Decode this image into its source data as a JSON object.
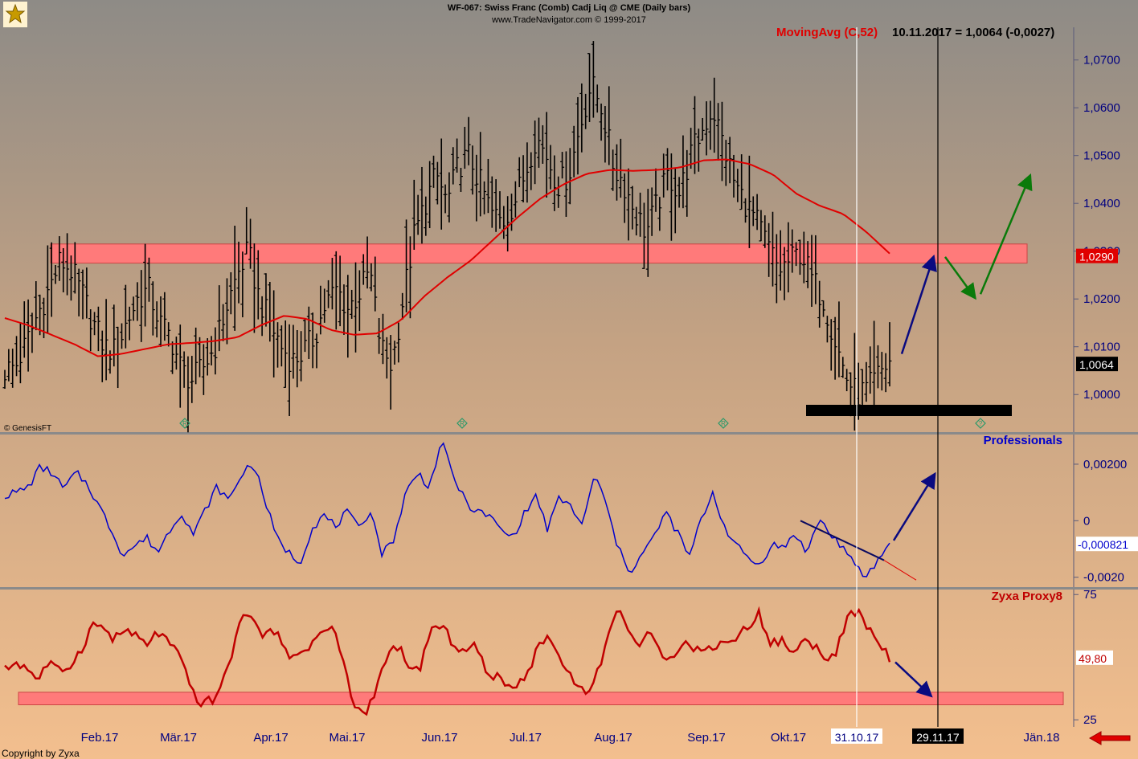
{
  "header": {
    "title": "WF-067:  Swiss Franc (Comb) Cadj Liq @ CME  (Daily bars)",
    "subtitle": "www.TradeNavigator.com © 1999-2017"
  },
  "logo_text": "GenesisFT",
  "copyright_left": "© GenesisFT",
  "footer_copyright": "Copyright by Zyxa",
  "colors": {
    "bg_top": "#8e8b86",
    "bg_bottom": "#f3bf8e",
    "price_bars": "#000000",
    "moving_avg": "#e00000",
    "professionals": "#0000cc",
    "zyxa": "#c00000",
    "zone": "#ff7a7a",
    "arrow_blue": "#0a0a80",
    "arrow_green": "#0a7a0a",
    "axis_text": "#000080"
  },
  "chart_data": [
    {
      "type": "ohlc",
      "panel": "price",
      "title": "WF-067:  Swiss Franc (Comb) Cadj Liq @ CME  (Daily bars)",
      "indicator_label": "MovingAvg (C,52)",
      "readout": "10.11.2017 = 1,0064 (-0,0027)",
      "last_value_label": "1,0064",
      "zone_value_label": "1,0290",
      "zone_range": [
        1.0275,
        1.0315
      ],
      "ylim": [
        0.9955,
        1.0765
      ],
      "yticks": [
        1.0,
        1.01,
        1.02,
        1.03,
        1.04,
        1.05,
        1.06,
        1.07
      ],
      "ytick_labels": [
        "1,0000",
        "1,0100",
        "1,0200",
        "1,0300",
        "1,0400",
        "1,0500",
        "1,0600",
        "1,0700"
      ],
      "close_path": [
        1.005,
        1.006,
        1.011,
        1.017,
        1.022,
        1.028,
        1.026,
        1.021,
        1.015,
        1.01,
        1.009,
        1.015,
        1.02,
        1.022,
        1.015,
        1.012,
        1.005,
        1.003,
        1.006,
        1.01,
        1.018,
        1.025,
        1.03,
        1.02,
        1.015,
        1.01,
        1.007,
        1.009,
        1.012,
        1.019,
        1.022,
        1.018,
        1.021,
        1.026,
        1.01,
        1.006,
        1.02,
        1.033,
        1.04,
        1.046,
        1.04,
        1.048,
        1.05,
        1.044,
        1.038,
        1.036,
        1.04,
        1.046,
        1.054,
        1.05,
        1.044,
        1.046,
        1.056,
        1.065,
        1.06,
        1.048,
        1.044,
        1.038,
        1.034,
        1.04,
        1.046,
        1.042,
        1.05,
        1.055,
        1.06,
        1.052,
        1.044,
        1.04,
        1.036,
        1.031,
        1.026,
        1.028,
        1.03,
        1.024,
        1.02,
        1.012,
        1.004,
        1.0,
        1.001,
        1.004,
        1.007
      ],
      "moving_avg_path": [
        1.016,
        1.0145,
        1.0125,
        1.0105,
        1.008,
        1.0085,
        1.0095,
        1.0105,
        1.0108,
        1.0112,
        1.012,
        1.0145,
        1.0165,
        1.0158,
        1.0135,
        1.0125,
        1.0128,
        1.0155,
        1.0205,
        1.0245,
        1.028,
        1.0325,
        1.037,
        1.041,
        1.044,
        1.0462,
        1.047,
        1.0468,
        1.047,
        1.0475,
        1.049,
        1.0492,
        1.0482,
        1.046,
        1.042,
        1.0395,
        1.0378,
        1.034,
        1.0295
      ],
      "x_dates": [
        "Feb.17",
        "Mär.17",
        "Apr.17",
        "Mai.17",
        "Jun.17",
        "Jul.17",
        "Aug.17",
        "Sep.17",
        "Okt.17",
        "31.10.17",
        "29.11.17",
        "Jän.18"
      ],
      "vlines": [
        "31.10.17",
        "29.11.17"
      ],
      "projection": {
        "from": 1.007,
        "up_to": 1.0285,
        "green_down": 1.0205,
        "green_up": 1.0455
      }
    },
    {
      "type": "line",
      "panel": "professionals",
      "name": "Professionals",
      "last_value_label": "-0,000821",
      "ylim": [
        -0.00235,
        0.00305
      ],
      "yticks": [
        -0.002,
        0,
        0.002
      ],
      "ytick_labels": [
        "-0,0020",
        "0",
        "0,00200"
      ],
      "values": [
        0.0009,
        0.001,
        0.0012,
        0.0019,
        0.0017,
        0.0011,
        0.0017,
        0.0013,
        0.0005,
        -0.0003,
        -0.0012,
        -0.0009,
        -0.0006,
        -0.0011,
        -0.0003,
        0.0003,
        -0.0005,
        0.0004,
        0.0012,
        0.0007,
        0.0016,
        0.0021,
        0.0008,
        -0.0006,
        -0.0011,
        -0.0015,
        -0.0003,
        0.0002,
        -0.0002,
        0.0003,
        -0.0003,
        0.0004,
        -0.0012,
        -0.0006,
        0.001,
        0.0017,
        0.0012,
        0.0028,
        0.0016,
        0.0007,
        0.0003,
        0.0002,
        -0.0003,
        -0.0006,
        0.0002,
        0.0009,
        -0.0003,
        0.0008,
        0.0005,
        -0.0002,
        0.0017,
        0.0005,
        -0.001,
        -0.0018,
        -0.0012,
        -0.0006,
        0.0003,
        -0.0004,
        -0.0013,
        0.0,
        0.001,
        -0.0002,
        -0.0009,
        -0.0013,
        -0.0016,
        -0.0008,
        -0.001,
        -0.0004,
        -0.0012,
        0.0001,
        -0.0005,
        -0.0009,
        -0.0016,
        -0.002,
        -0.0014,
        -0.0008
      ],
      "trendline": {
        "from": 0.0,
        "to": -0.0021
      }
    },
    {
      "type": "line",
      "panel": "zyxa",
      "name": "Zyxa Proxy8",
      "last_value_label": "49,80",
      "ylim": [
        22.5,
        77
      ],
      "yticks": [
        25,
        75
      ],
      "ytick_labels": [
        "25",
        "75"
      ],
      "zone_range": [
        31,
        36
      ],
      "values": [
        45,
        48,
        46,
        41,
        48,
        44,
        47,
        53,
        63,
        62,
        57,
        61,
        58,
        55,
        60,
        56,
        50,
        38,
        31,
        33,
        40,
        55,
        70,
        62,
        58,
        62,
        48,
        52,
        55,
        60,
        62,
        48,
        30,
        27,
        38,
        50,
        55,
        44,
        46,
        61,
        62,
        56,
        52,
        55,
        45,
        42,
        38,
        40,
        45,
        56,
        58,
        47,
        42,
        36,
        40,
        55,
        69,
        63,
        54,
        59,
        52,
        50,
        56,
        54,
        52,
        55,
        56,
        58,
        62,
        68,
        55,
        57,
        52,
        56,
        55,
        51,
        50,
        65,
        68,
        62,
        55,
        50
      ],
      "projection_to": 35
    }
  ]
}
